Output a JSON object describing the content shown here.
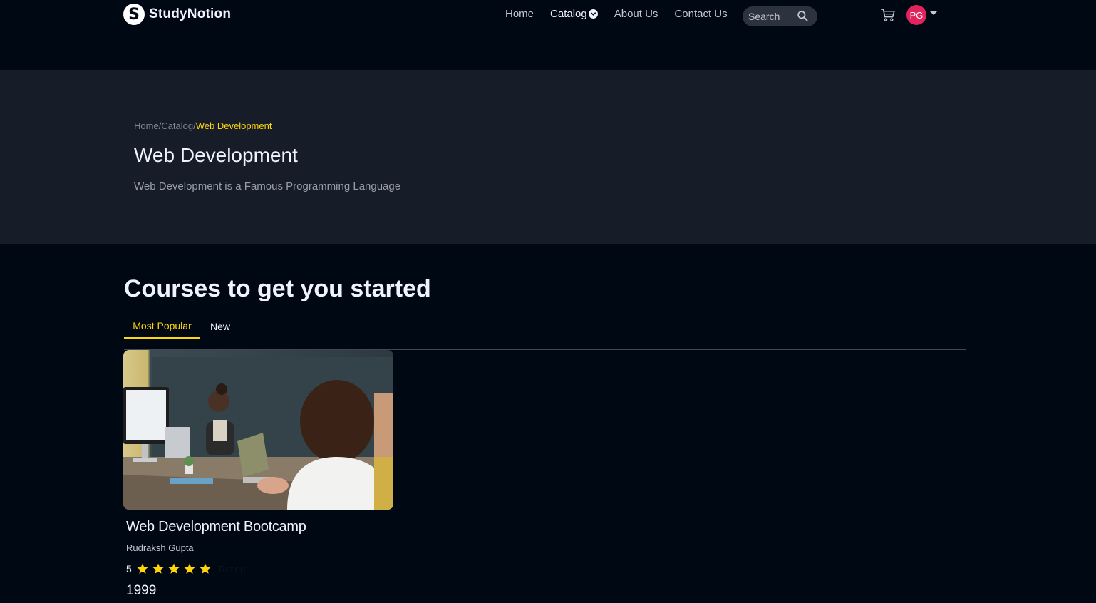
{
  "brand": {
    "name": "StudyNotion",
    "logo_letter": "S"
  },
  "nav": {
    "links": [
      {
        "label": "Home"
      },
      {
        "label": "Catalog"
      },
      {
        "label": "About Us"
      },
      {
        "label": "Contact Us"
      }
    ],
    "search_placeholder": "Search",
    "avatar_initials": "PG"
  },
  "hero": {
    "breadcrumb": [
      "Home",
      "Catalog",
      "Web Development"
    ],
    "separator": "/",
    "title": "Web Development",
    "description": "Web Development is a Famous Programming Language"
  },
  "section": {
    "title": "Courses to get you started",
    "tabs": [
      {
        "label": "Most Popular",
        "active": true
      },
      {
        "label": "New",
        "active": false
      }
    ]
  },
  "course": {
    "title": "Web Development Bootcamp",
    "instructor": "Rudraksh Gupta",
    "rating": "5",
    "stars": 5,
    "rating_label": "Rating",
    "price": "1999"
  },
  "colors": {
    "accent_yellow": "#ffd60a",
    "avatar_pink": "#e2245e",
    "page_bg": "#000814",
    "hero_bg": "#161d29"
  }
}
